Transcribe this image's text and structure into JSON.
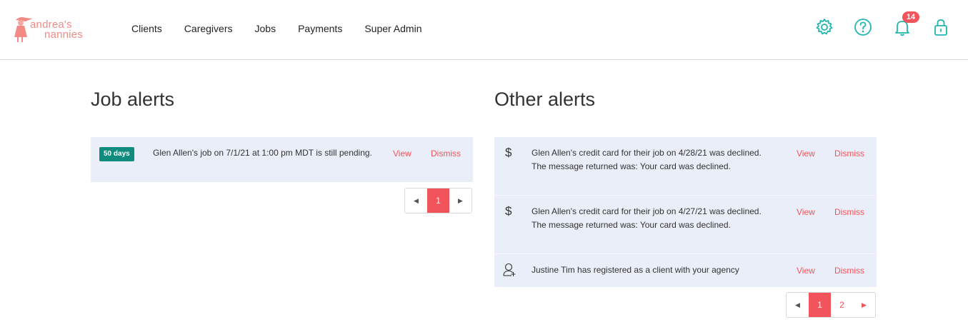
{
  "brand": {
    "line1": "andrea's",
    "line2": "nannies",
    "color": "#f28b86"
  },
  "nav": {
    "items": [
      {
        "label": "Clients"
      },
      {
        "label": "Caregivers"
      },
      {
        "label": "Jobs"
      },
      {
        "label": "Payments"
      },
      {
        "label": "Super Admin"
      }
    ]
  },
  "header_icons": {
    "settings": "gear-icon",
    "help": "question-icon",
    "notifications": "bell-icon",
    "notification_count": "14",
    "lock": "lock-icon",
    "accent": "#1fb6b0"
  },
  "job_alerts": {
    "title": "Job alerts",
    "items": [
      {
        "tag": "50 days",
        "text": "Glen Allen's job on 7/1/21 at 1:00 pm MDT is still pending.",
        "view": "View",
        "dismiss": "Dismiss"
      }
    ],
    "pagination": {
      "pages": [
        "1"
      ],
      "current": "1"
    }
  },
  "other_alerts": {
    "title": "Other alerts",
    "items": [
      {
        "icon": "dollar-icon",
        "icon_glyph": "$",
        "text": "Glen Allen's credit card for their job on 4/28/21 was declined. The message returned was: Your card was declined.",
        "view": "View",
        "dismiss": "Dismiss"
      },
      {
        "icon": "dollar-icon",
        "icon_glyph": "$",
        "text": "Glen Allen's credit card for their job on 4/27/21 was declined. The message returned was: Your card was declined.",
        "view": "View",
        "dismiss": "Dismiss"
      },
      {
        "icon": "user-add-icon",
        "icon_glyph": "",
        "text": "Justine Tim has registered as a client with your agency",
        "view": "View",
        "dismiss": "Dismiss"
      }
    ],
    "pagination": {
      "pages": [
        "1",
        "2"
      ],
      "current": "1"
    }
  },
  "colors": {
    "accent_red": "#f2545b",
    "tag_teal": "#0f8c7e",
    "panel_bg": "#e9eef8"
  }
}
